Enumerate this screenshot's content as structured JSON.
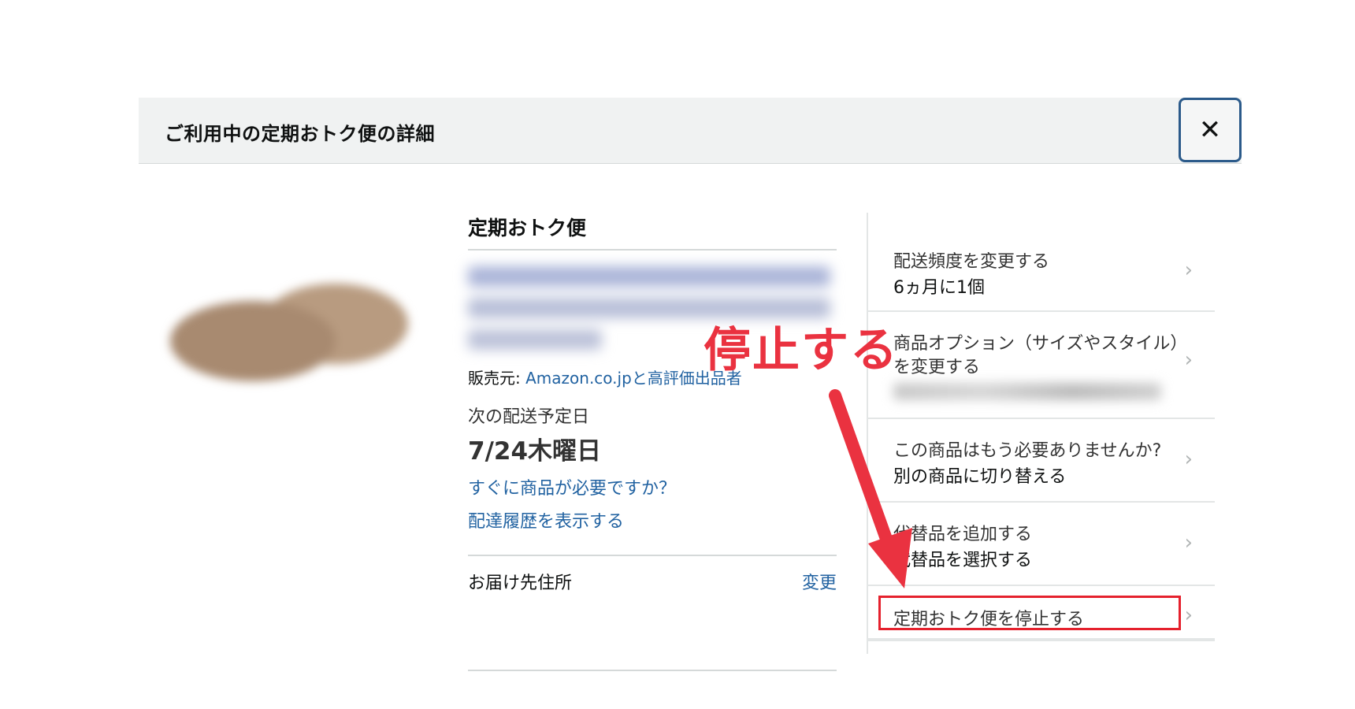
{
  "header": {
    "title": "ご利用中の定期おトク便の詳細",
    "close_icon": "✕"
  },
  "product": {
    "section_title": "定期おトク便",
    "seller_label": "販売元: ",
    "seller_value": "Amazon.co.jpと高評価出品者",
    "next_delivery_label": "次の配送予定日",
    "next_delivery_date": "7/24木曜日",
    "need_soon_link": "すぐに商品が必要ですか？",
    "history_link": "配達履歴を表示する",
    "address_label": "お届け先住所",
    "address_change": "変更"
  },
  "options": [
    {
      "line1": "配送頻度を変更する",
      "line2": "6ヵ月に1個"
    },
    {
      "line1": "商品オプション（サイズやスタイル）",
      "line1b": "を変更する"
    },
    {
      "line1": "この商品はもう必要ありませんか?",
      "line2": "別の商品に切り替える"
    },
    {
      "line1": "代替品を追加する",
      "line2": "代替品を選択する"
    },
    {
      "line1": "定期おトク便を停止する"
    }
  ],
  "annotation": {
    "text": "停止する",
    "color": "#ea3240",
    "highlight_color": "#e5212d"
  }
}
